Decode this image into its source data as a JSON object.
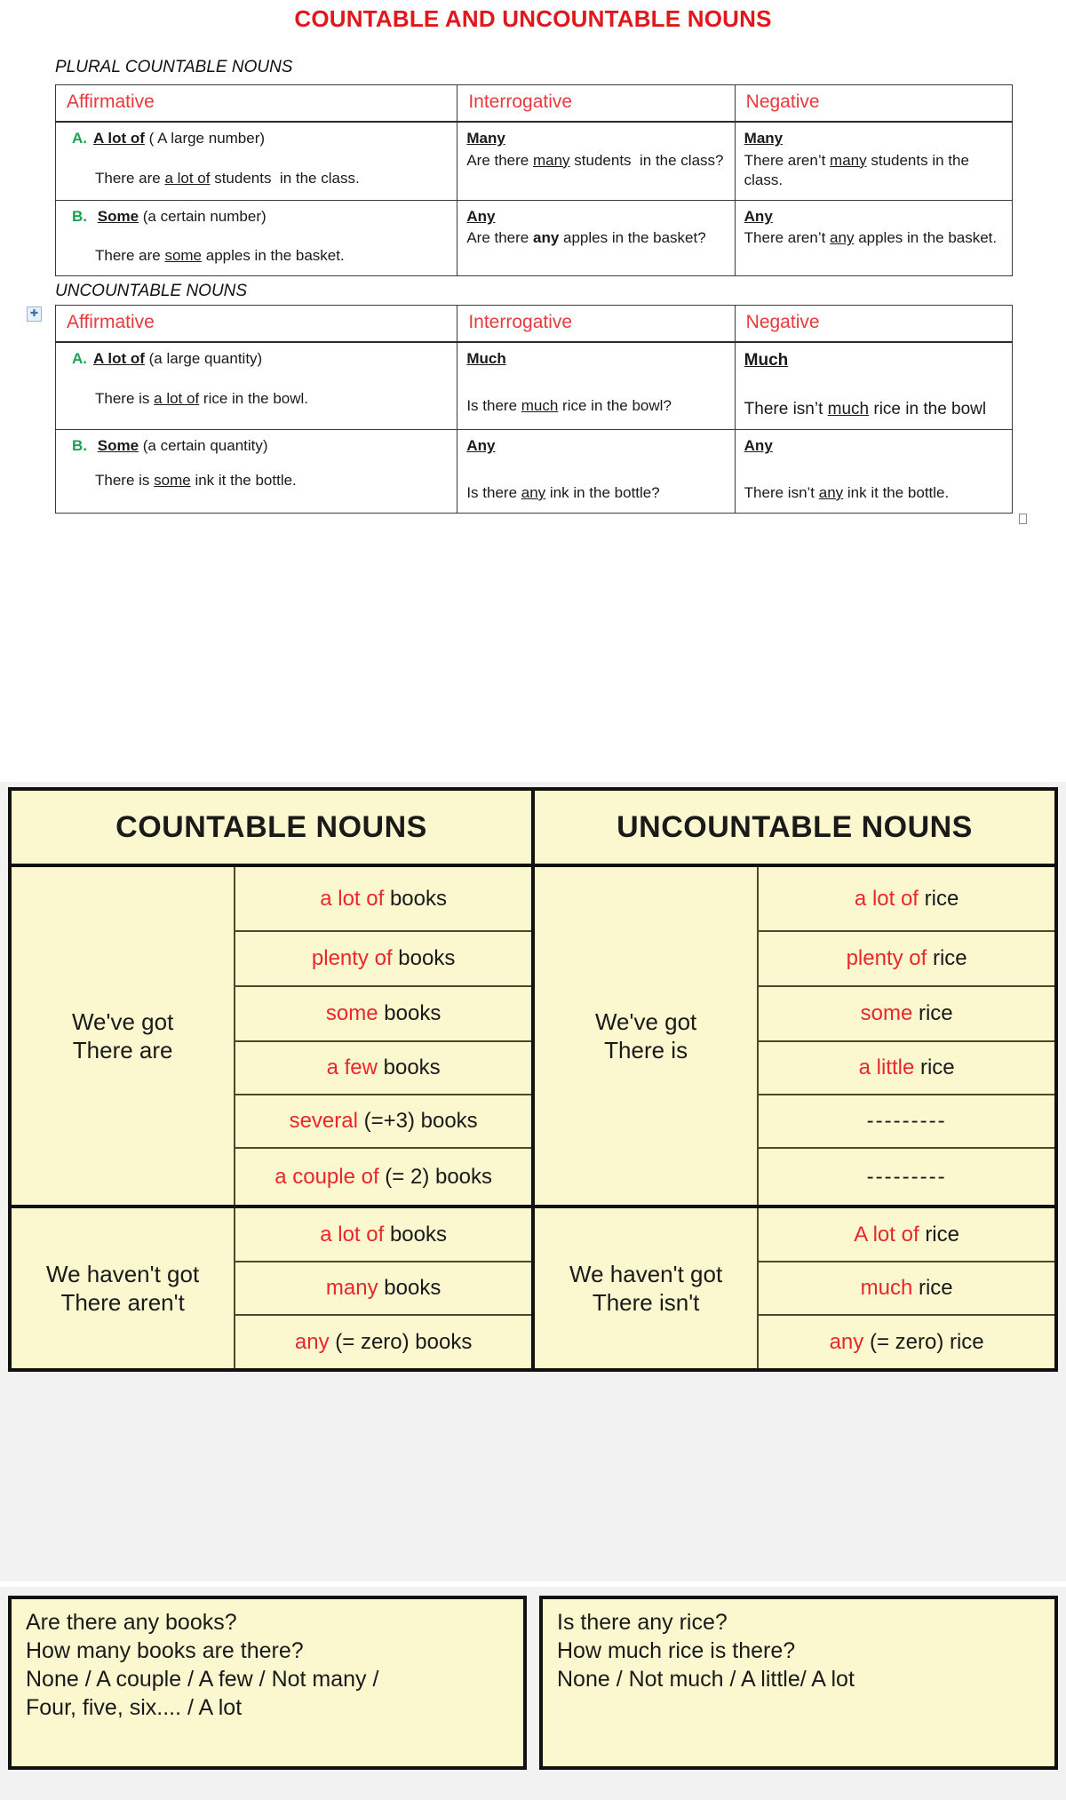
{
  "document": {
    "title": "COUNTABLE AND UNCOUNTABLE NOUNS",
    "title_color": "#e0181c",
    "section1_label": "PLURAL COUNTABLE NOUNS",
    "section2_label": "UNCOUNTABLE NOUNS"
  },
  "grammar_table_headers": {
    "affirmative": "Affirmative",
    "interrogative": "Interrogative",
    "negative": "Negative",
    "header_color": "#e8393c"
  },
  "plural_countable": {
    "rows": [
      {
        "letter": "A.",
        "affirmative_term": "A lot of",
        "affirmative_gloss": "( A large number)",
        "affirmative_example": "There are a lot of students in the class.",
        "affirmative_example_underlined": "a lot of",
        "interrogative_term": "Many",
        "interrogative_example": "Are there many students in the class?",
        "interrogative_example_underlined": "many",
        "negative_term": "Many",
        "negative_example": "There aren't many students in the class.",
        "negative_example_underlined": "many"
      },
      {
        "letter": "B.",
        "affirmative_term": "Some",
        "affirmative_gloss": "(a certain number)",
        "affirmative_example": "There are some apples in the basket.",
        "affirmative_example_underlined": "some",
        "interrogative_term": "Any",
        "interrogative_example": "Are there any apples in the basket?",
        "interrogative_example_underlined": "any",
        "negative_term": "Any",
        "negative_example": "There aren't any apples in the basket.",
        "negative_example_underlined": "any"
      }
    ]
  },
  "uncountable": {
    "rows": [
      {
        "letter": "A.",
        "affirmative_term": "A lot of",
        "affirmative_gloss": "(a large quantity)",
        "affirmative_example": "There is a lot of rice in the bowl.",
        "affirmative_example_underlined": "a lot of",
        "interrogative_term": "Much",
        "interrogative_example": "Is there much rice in the bowl?",
        "interrogative_example_underlined": "much",
        "negative_term": "Much",
        "negative_example": "There isn't much rice in the bowl",
        "negative_example_underlined": "much"
      },
      {
        "letter": "B.",
        "affirmative_term": "Some",
        "affirmative_gloss": "(a certain quantity)",
        "affirmative_example": "There is some ink it the bottle.",
        "affirmative_example_underlined": "some",
        "interrogative_term": "Any",
        "interrogative_example": "Is there any ink in the bottle?",
        "interrogative_example_underlined": "any",
        "negative_term": "Any",
        "negative_example": "There isn't any ink it the bottle.",
        "negative_example_underlined": "any"
      }
    ]
  },
  "chart": {
    "background": "#fbf8cf",
    "quantifier_color": "#e8272c",
    "headers": {
      "countable": "COUNTABLE NOUNS",
      "uncountable": "UNCOUNTABLE NOUNS"
    },
    "affirmative": {
      "countable_subject": "We've got\nThere are",
      "countable_subject_line1": "We've got",
      "countable_subject_line2": "There are",
      "uncountable_subject_line1": "We've got",
      "uncountable_subject_line2": "There is",
      "countable_items": [
        {
          "quantifier": "a lot of",
          "noun": "books"
        },
        {
          "quantifier": "plenty of",
          "noun": "books"
        },
        {
          "quantifier": "some",
          "noun": "books"
        },
        {
          "quantifier": "a few",
          "noun": "books"
        },
        {
          "quantifier": "several",
          "noun": "(=+3) books"
        },
        {
          "quantifier": "a couple of",
          "noun": "(= 2) books"
        }
      ],
      "uncountable_items": [
        {
          "quantifier": "a lot of",
          "noun": "rice"
        },
        {
          "quantifier": "plenty of",
          "noun": "rice"
        },
        {
          "quantifier": "some",
          "noun": "rice"
        },
        {
          "quantifier": "a little",
          "noun": "rice"
        },
        {
          "quantifier": "",
          "noun": "---------"
        },
        {
          "quantifier": "",
          "noun": "---------"
        }
      ]
    },
    "negative": {
      "countable_subject_line1": "We haven't got",
      "countable_subject_line2": "There aren't",
      "uncountable_subject_line1": "We haven't got",
      "uncountable_subject_line2": "There isn't",
      "countable_items": [
        {
          "quantifier": "a lot of",
          "noun": "books"
        },
        {
          "quantifier": "many",
          "noun": "books"
        },
        {
          "quantifier": "any",
          "noun": "(= zero) books"
        }
      ],
      "uncountable_items": [
        {
          "quantifier": "A lot of",
          "noun": "rice"
        },
        {
          "quantifier": "much",
          "noun": "rice"
        },
        {
          "quantifier": "any",
          "noun": "(= zero) rice"
        }
      ]
    }
  },
  "question_boxes": {
    "countable": [
      "Are there any books?",
      "How many books are there?",
      "None / A couple / A few / Not many /",
      "Four, five, six.... / A lot"
    ],
    "uncountable": [
      "Is there any rice?",
      "How much rice is there?",
      "None / Not much / A little/ A lot"
    ]
  },
  "icons": {
    "table_move_handle": "table-move-handle-icon",
    "table_resize_handle": "table-resize-handle-icon"
  }
}
